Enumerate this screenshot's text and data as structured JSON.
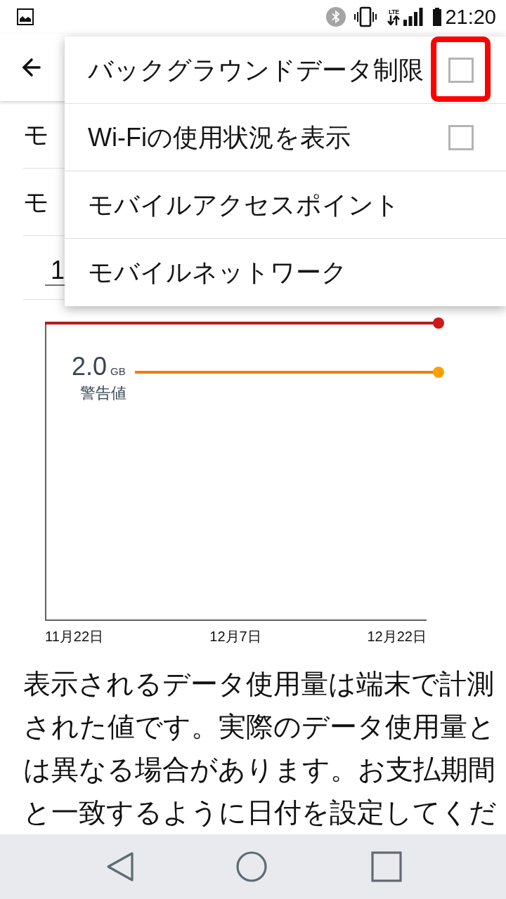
{
  "status_bar": {
    "network_type": "LTE",
    "time": "21:20"
  },
  "settings_rows": [
    {
      "kind": "text",
      "label": "モ"
    },
    {
      "kind": "text",
      "label": "モ"
    },
    {
      "kind": "spinner",
      "value": "1"
    }
  ],
  "chart": {
    "warning_value": "2.0",
    "warning_unit": "GB",
    "warning_label": "警告値",
    "x_labels": [
      "11月22日",
      "12月7日",
      "12月22日"
    ]
  },
  "description": "表示されるデータ使用量は端末で計測された値です。実際のデータ使用量とは異なる場合があります。お支払期間と一致するように日付を設定してくだ",
  "menu": {
    "items": [
      {
        "kind": "checkbox",
        "label": "バックグラウンドデータ制限",
        "checked": false,
        "highlighted": true
      },
      {
        "kind": "checkbox",
        "label": "Wi-Fiの使用状況を表示",
        "checked": false,
        "highlighted": false
      },
      {
        "kind": "link",
        "label": "モバイルアクセスポイント",
        "highlighted": false
      },
      {
        "kind": "link",
        "label": "モバイルネットワーク",
        "highlighted": false
      }
    ]
  }
}
